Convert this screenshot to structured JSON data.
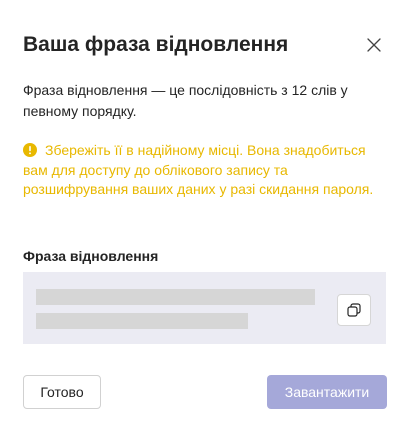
{
  "dialog": {
    "title": "Ваша фраза відновлення",
    "close_icon": "close-icon",
    "description": "Фраза відновлення — це послідовність з 12 слів у певному порядку.",
    "warning": {
      "icon": "exclamation-circle-icon",
      "text": "Збережіть її в надійному місці. Вона знадобиться вам для доступу до облікового запису та розшифрування ваших даних у разі скидання пароля.",
      "color": "#e8b800"
    },
    "phrase": {
      "label": "Фраза відновлення",
      "copy_icon": "copy-icon"
    },
    "buttons": {
      "done_label": "Готово",
      "download_label": "Завантажити",
      "download_color": "#a5a8d9"
    }
  }
}
